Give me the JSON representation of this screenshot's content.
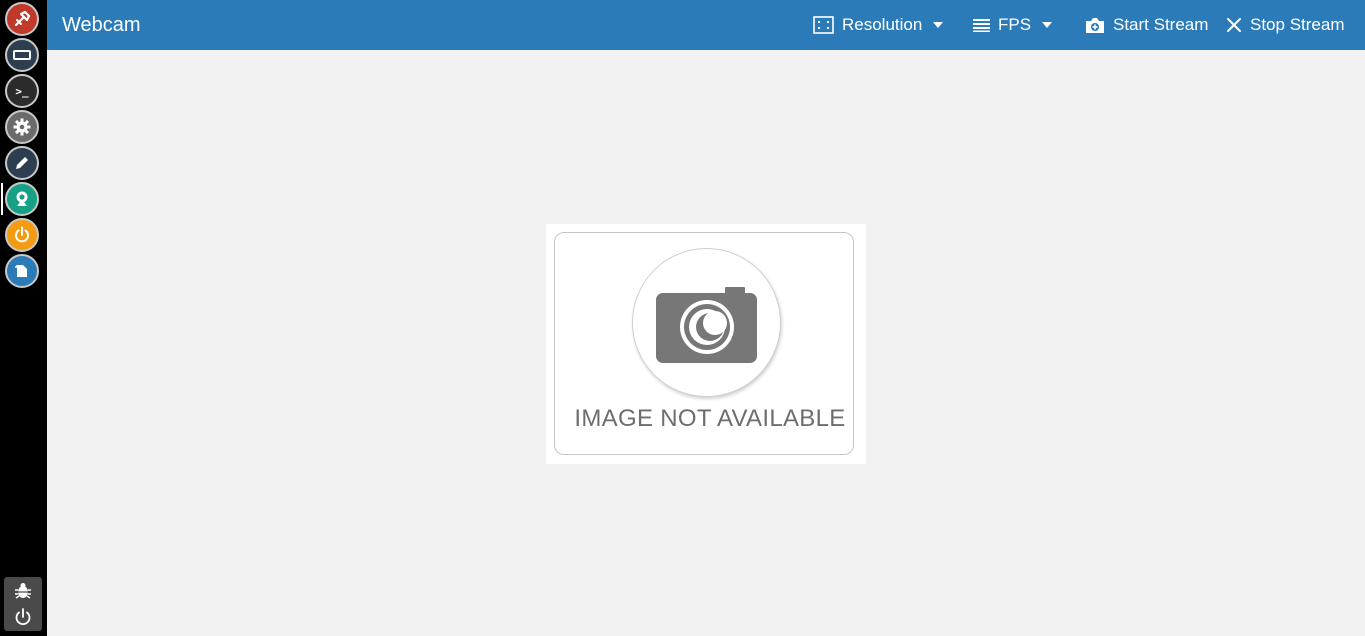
{
  "app": {
    "title": "Webcam"
  },
  "rail": {
    "items": [
      {
        "icon": "wrench-icon",
        "color": "#c0392b"
      },
      {
        "icon": "screen-icon",
        "color": "#2c3e50"
      },
      {
        "icon": "terminal-icon",
        "color": "#2b2b2b",
        "glyph": ">_"
      },
      {
        "icon": "gear-icon",
        "color": "#6b6b6b"
      },
      {
        "icon": "pencil-icon",
        "color": "#2c3e50"
      },
      {
        "icon": "webcam-icon",
        "color": "#16a085",
        "active": true
      },
      {
        "icon": "power-icon",
        "color": "#f39c12"
      },
      {
        "icon": "folder-icon",
        "color": "#2b7bb9"
      }
    ],
    "bottom": [
      {
        "icon": "bug-icon"
      },
      {
        "icon": "power-icon"
      }
    ]
  },
  "toolbar": {
    "resolution_label": "Resolution",
    "fps_label": "FPS",
    "start_label": "Start Stream",
    "stop_label": "Stop Stream"
  },
  "stream": {
    "placeholder_text": "IMAGE NOT AVAILABLE"
  },
  "colors": {
    "topbar": "#2b7bb9",
    "rail": "#000000",
    "background": "#f2f2f2"
  }
}
